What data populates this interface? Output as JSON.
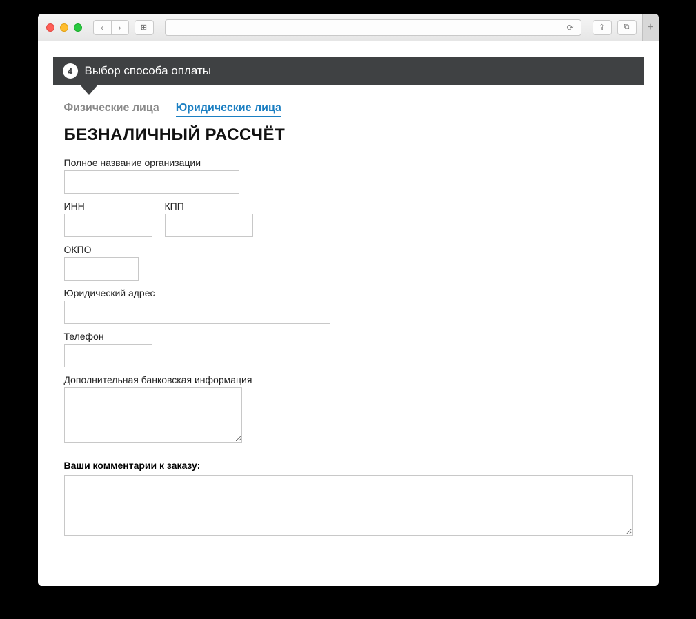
{
  "browser": {
    "back_icon": "‹",
    "forward_icon": "›",
    "sidebar_icon": "⊞",
    "reload_icon": "⟳",
    "share_icon": "⇪",
    "tabs_icon": "⧉",
    "newtab_icon": "+"
  },
  "step": {
    "number": "4",
    "title": "Выбор способа оплаты"
  },
  "tabs": {
    "individuals": "Физические лица",
    "legal": "Юридические лица"
  },
  "section_title": "БЕЗНАЛИЧНЫЙ РАССЧЁТ",
  "form": {
    "org_name_label": "Полное название организации",
    "org_name_value": "",
    "inn_label": "ИНН",
    "inn_value": "",
    "kpp_label": "КПП",
    "kpp_value": "",
    "okpo_label": "ОКПО",
    "okpo_value": "",
    "address_label": "Юридический адрес",
    "address_value": "",
    "phone_label": "Телефон",
    "phone_value": "",
    "bank_label": "Дополнительная банковская информация",
    "bank_value": "",
    "comments_label": "Ваши комментарии к заказу:",
    "comments_value": ""
  }
}
